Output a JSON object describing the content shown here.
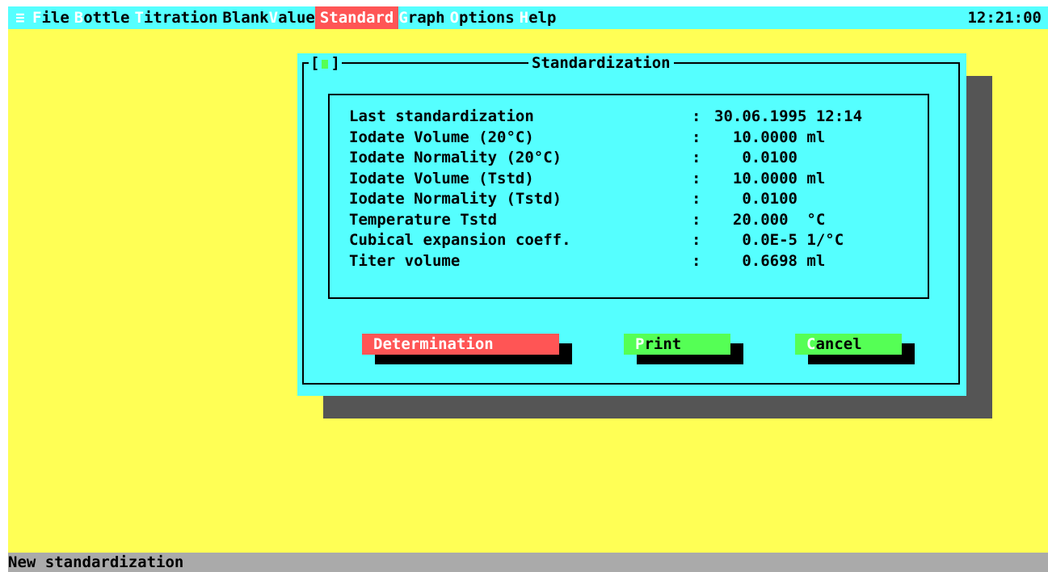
{
  "menubar": {
    "system_icon": "≡",
    "items": [
      {
        "hotkey": "F",
        "rest": "ile",
        "active": false
      },
      {
        "hotkey": "B",
        "rest": "ottle",
        "active": false
      },
      {
        "hotkey": "T",
        "rest": "itration",
        "active": false
      },
      {
        "pre": "Blank",
        "hotkey": "V",
        "rest": "alue",
        "active": false
      },
      {
        "hotkey": "",
        "rest": "Standard",
        "active": true
      },
      {
        "hotkey": "G",
        "rest": "raph",
        "active": false
      },
      {
        "hotkey": "O",
        "rest": "ptions",
        "active": false
      },
      {
        "hotkey": "H",
        "rest": "elp",
        "active": false
      }
    ],
    "clock": "12:21:00"
  },
  "dialog": {
    "close_label_left": "[",
    "close_label_right": "]",
    "title": "Standardization",
    "rows": [
      {
        "label": "Last standardization",
        "colon": ":",
        "value": "30.06.1995 12:14"
      },
      {
        "label": "Iodate Volume (20°C)",
        "colon": ":",
        "value": "  10.0000 ml"
      },
      {
        "label": "Iodate Normality (20°C)",
        "colon": ":",
        "value": "   0.0100"
      },
      {
        "label": "Iodate Volume (Tstd)",
        "colon": ":",
        "value": "  10.0000 ml"
      },
      {
        "label": "Iodate Normality (Tstd)",
        "colon": ":",
        "value": "   0.0100"
      },
      {
        "label": "Temperature Tstd",
        "colon": ":",
        "value": "  20.000  °C"
      },
      {
        "label": "Cubical expansion coeff.",
        "colon": ":",
        "value": "   0.0E-5 1/°C"
      },
      {
        "label": "Titer volume",
        "colon": ":",
        "value": "   0.6698 ml"
      }
    ],
    "buttons": {
      "determination": {
        "hotkey": "",
        "rest": "Determination"
      },
      "print": {
        "hotkey": "P",
        "rest": "rint"
      },
      "cancel": {
        "hotkey": "C",
        "rest": "ancel"
      }
    }
  },
  "statusbar": {
    "text": "New standardization"
  },
  "colors": {
    "desktop": "#ffff55",
    "menubar": "#55ffff",
    "dialog": "#55ffff",
    "active_menu": "#ff5555",
    "status": "#aaaaaa",
    "button_green": "#55ff55",
    "button_red": "#ff5555"
  }
}
